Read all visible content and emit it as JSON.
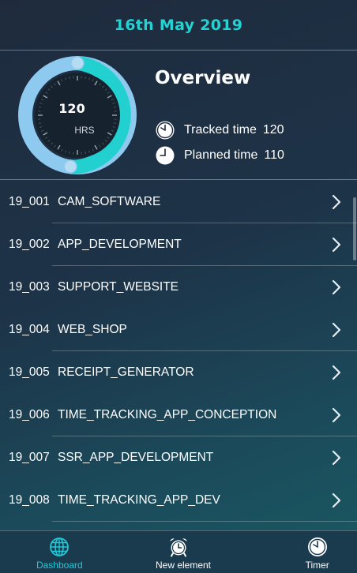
{
  "header": {
    "date": "16th May 2019"
  },
  "overview": {
    "title": "Overview",
    "hours": "120",
    "hours_unit": "HRS",
    "tracked_label": "Tracked time",
    "tracked_value": "120",
    "planned_label": "Planned time",
    "planned_value": "110",
    "colors": {
      "ring_track": "#8ec9ef",
      "ring_progress": "#22d1cf",
      "accent": "#25d2d2"
    }
  },
  "projects": [
    {
      "id": "19_001",
      "name": "CAM_SOFTWARE"
    },
    {
      "id": "19_002",
      "name": "APP_DEVELOPMENT"
    },
    {
      "id": "19_003",
      "name": "SUPPORT_WEBSITE"
    },
    {
      "id": "19_004",
      "name": "WEB_SHOP"
    },
    {
      "id": "19_005",
      "name": "RECEIPT_GENERATOR"
    },
    {
      "id": "19_006",
      "name": "TIME_TRACKING_APP_CONCEPTION"
    },
    {
      "id": "19_007",
      "name": "SSR_APP_DEVELOPMENT"
    },
    {
      "id": "19_008",
      "name": "TIME_TRACKING_APP_DEV"
    }
  ],
  "nav": {
    "dashboard": {
      "label": "Dashboard",
      "icon": "globe-icon"
    },
    "new_element": {
      "label": "New element",
      "icon": "alarm-clock-icon"
    },
    "timer": {
      "label": "Timer",
      "icon": "clock-icon"
    }
  }
}
